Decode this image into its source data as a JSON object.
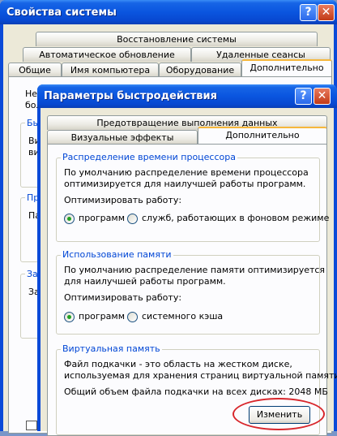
{
  "back_window": {
    "title": "Свойства системы",
    "help_glyph": "?",
    "close_glyph": "✕",
    "tabs_row1": [
      "Восстановление системы"
    ],
    "tabs_row2": [
      "Автоматическое обновление",
      "Удаленные сеансы"
    ],
    "tabs_row3": [
      "Общие",
      "Имя компьютера",
      "Оборудование",
      "Дополнительно"
    ],
    "partial_text": [
      "Нео",
      "бол",
      "Бы",
      "Ви",
      "ви",
      "Пр",
      "Па",
      "За",
      "За"
    ]
  },
  "dialog": {
    "title": "Параметры быстродействия",
    "help_glyph": "?",
    "close_glyph": "✕",
    "tabs": {
      "dep": "Предотвращение выполнения данных",
      "visual": "Визуальные эффекты",
      "advanced": "Дополнительно"
    },
    "cpu_group": {
      "label": "Распределение времени процессора",
      "desc1": "По умолчанию распределение времени процессора",
      "desc2": "оптимизируется для наилучшей работы программ.",
      "optimize_label": "Оптимизировать работу:",
      "option_programs": "программ",
      "option_services": "служб, работающих в фоновом режиме",
      "selected": "программ"
    },
    "memory_group": {
      "label": "Использование памяти",
      "desc1": "По умолчанию распределение памяти оптимизируется",
      "desc2": "для наилучшей работы программ.",
      "optimize_label": "Оптимизировать работу:",
      "option_programs": "программ",
      "option_cache": "системного кэша",
      "selected": "программ"
    },
    "vm_group": {
      "label": "Виртуальная память",
      "desc1": "Файл подкачки - это область на жестком диске,",
      "desc2": "используемая для хранения страниц виртуальной памяти.",
      "total": "Общий объем файла подкачки на всех дисках: 2048 МБ",
      "change_button": "Изменить"
    }
  },
  "colors": {
    "title_blue": "#0a55df",
    "groupbox_label": "#0046d5",
    "annotation_red": "#d8262b",
    "face": "#ece9d8"
  }
}
